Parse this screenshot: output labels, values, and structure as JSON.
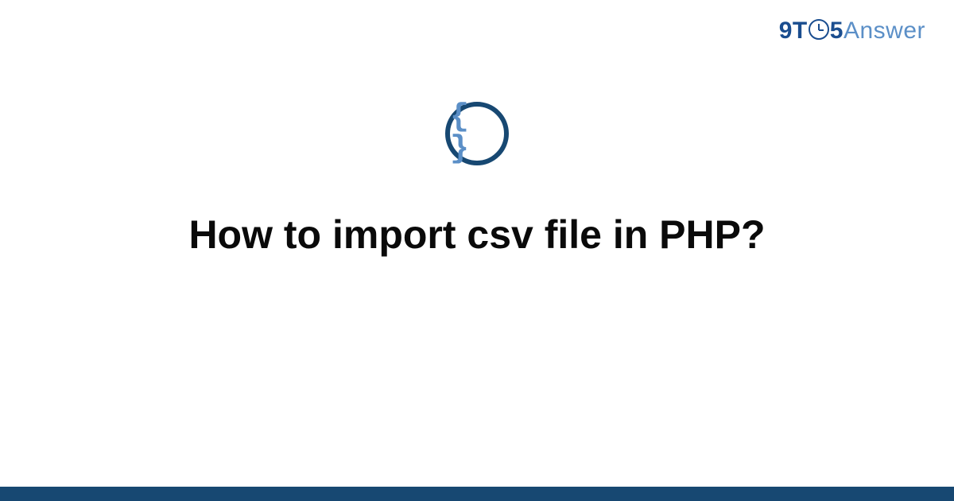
{
  "logo": {
    "part1": "9T",
    "part2": "5",
    "part3": "Answer"
  },
  "icon": {
    "braces": "{ }"
  },
  "question": {
    "title": "How to import csv file in PHP?"
  },
  "colors": {
    "primary_dark": "#174872",
    "primary_light": "#5b8fc7",
    "logo_blue": "#1a4d8f"
  }
}
